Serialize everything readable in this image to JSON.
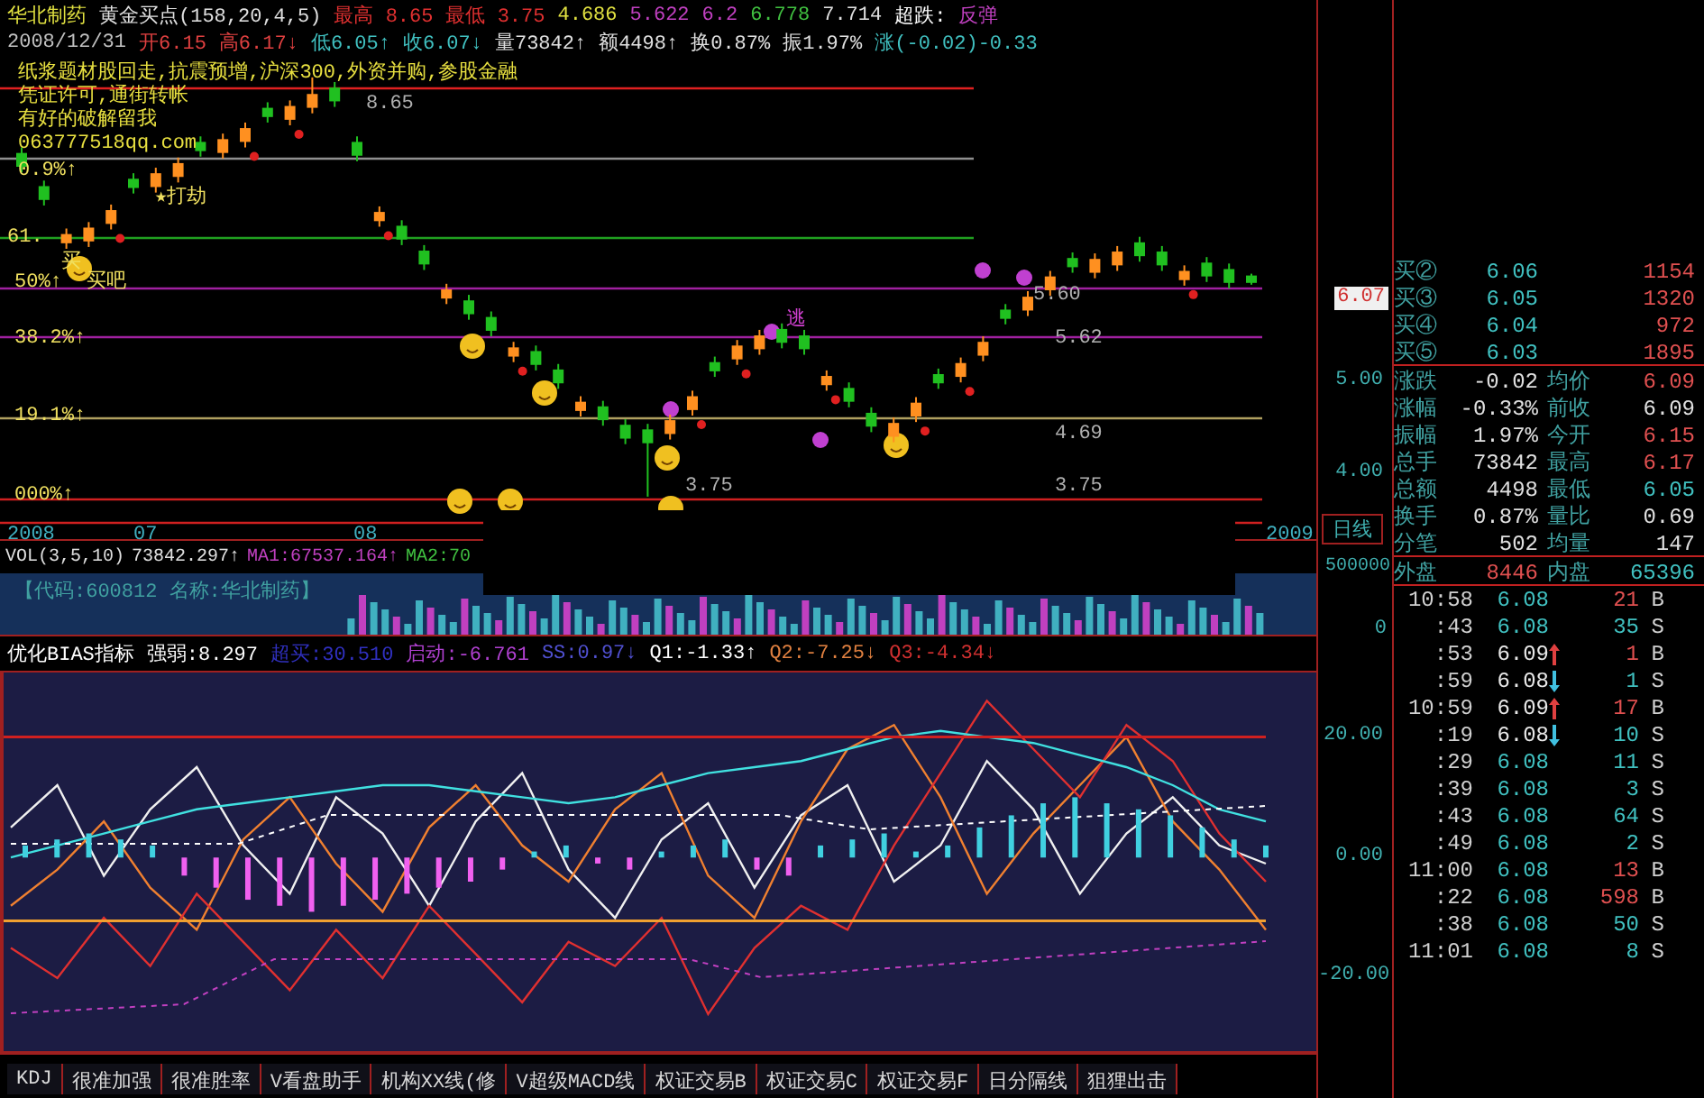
{
  "header": {
    "stock_name": "华北制药",
    "indicator_name": "黄金买点(158,20,4,5)",
    "indicator_values": [
      {
        "text": "最高 8.65",
        "color": "#e03030"
      },
      {
        "text": "最低 3.75",
        "color": "#e03030"
      },
      {
        "text": "4.686",
        "color": "#e0e040"
      },
      {
        "text": "5.622",
        "color": "#c040c0"
      },
      {
        "text": "6.2",
        "color": "#c040c0"
      },
      {
        "text": "6.778",
        "color": "#40c040"
      },
      {
        "text": "7.714",
        "color": "#e0e0e0"
      },
      {
        "text": "超跌:",
        "color": "#ffffff"
      },
      {
        "text": "反弹",
        "color": "#c040c0"
      }
    ],
    "quote_line": [
      {
        "text": "2008/12/31",
        "color": "#c0c0c0"
      },
      {
        "text": "开6.15",
        "color": "#e04040"
      },
      {
        "text": "高6.17↓",
        "color": "#e04040"
      },
      {
        "text": "低6.05↑",
        "color": "#40c0c0"
      },
      {
        "text": "收6.07↓",
        "color": "#40c0c0"
      },
      {
        "text": "量73842↑",
        "color": "#e0e0e0"
      },
      {
        "text": "额4498↑",
        "color": "#e0e0e0"
      },
      {
        "text": "换0.87%",
        "color": "#e0e0e0"
      },
      {
        "text": "振1.97%",
        "color": "#e0e0e0"
      },
      {
        "text": "涨(-0.02)-0.33",
        "color": "#40c0c0"
      }
    ]
  },
  "notes": [
    "纸浆题材股回走,抗震预增,沪深300,外资并购,参股金融",
    "凭证许可,通街转帐",
    "有好的破解留我",
    "063777518qq.com"
  ],
  "kline_labels": [
    {
      "text": "8.65",
      "kind": "price"
    },
    {
      "text": "★打劫",
      "kind": "signal"
    },
    {
      "text": "0.9%↑",
      "kind": "level"
    },
    {
      "text": "61.",
      "kind": "level"
    },
    {
      "text": "买",
      "kind": "signal"
    },
    {
      "text": "50%↑",
      "kind": "level"
    },
    {
      "text": "买吧",
      "kind": "signal"
    },
    {
      "text": "38.2%↑",
      "kind": "level"
    },
    {
      "text": "19.1%↑",
      "kind": "level"
    },
    {
      "text": "000%↑",
      "kind": "level"
    },
    {
      "text": "逃",
      "kind": "escape"
    },
    {
      "text": "5.60",
      "kind": "price"
    },
    {
      "text": "5.62",
      "kind": "price"
    },
    {
      "text": "4.69",
      "kind": "price"
    },
    {
      "text": "3.75",
      "kind": "price"
    },
    {
      "text": "3.75",
      "kind": "price"
    }
  ],
  "time_axis": [
    "2008",
    "07",
    "08",
    "2009"
  ],
  "kline": {
    "chart_data": {
      "type": "candlestick",
      "ylim": [
        3.27,
        9.14
      ],
      "yticks": [
        {
          "value": 5,
          "label": "5.00"
        },
        {
          "value": 4,
          "label": "4.00"
        }
      ],
      "ohlc": [
        [
          7.48,
          7.54,
          7.27,
          7.33
        ],
        [
          7.12,
          7.18,
          6.91,
          6.97
        ],
        [
          6.5,
          6.66,
          6.44,
          6.6
        ],
        [
          6.52,
          6.73,
          6.46,
          6.67
        ],
        [
          6.71,
          6.92,
          6.65,
          6.86
        ],
        [
          7.2,
          7.26,
          7.04,
          7.1
        ],
        [
          7.11,
          7.32,
          7.05,
          7.26
        ],
        [
          7.22,
          7.43,
          7.16,
          7.37
        ],
        [
          7.6,
          7.66,
          7.44,
          7.5
        ],
        [
          7.48,
          7.69,
          7.42,
          7.63
        ],
        [
          7.6,
          7.81,
          7.54,
          7.75
        ],
        [
          7.97,
          8.03,
          7.81,
          7.87
        ],
        [
          7.84,
          8.05,
          7.78,
          7.99
        ],
        [
          7.97,
          8.3,
          7.91,
          8.12
        ],
        [
          8.19,
          8.25,
          7.98,
          8.04
        ],
        [
          7.6,
          7.66,
          7.39,
          7.45
        ],
        [
          6.74,
          6.9,
          6.68,
          6.84
        ],
        [
          6.69,
          6.75,
          6.48,
          6.54
        ],
        [
          6.42,
          6.48,
          6.21,
          6.27
        ],
        [
          5.9,
          6.06,
          5.84,
          6.0
        ],
        [
          5.88,
          5.94,
          5.67,
          5.73
        ],
        [
          5.7,
          5.76,
          5.49,
          5.55
        ],
        [
          5.27,
          5.43,
          5.21,
          5.37
        ],
        [
          5.33,
          5.39,
          5.12,
          5.18
        ],
        [
          5.13,
          5.19,
          4.92,
          4.98
        ],
        [
          4.68,
          4.84,
          4.62,
          4.78
        ],
        [
          4.73,
          4.79,
          4.52,
          4.58
        ],
        [
          4.53,
          4.59,
          4.32,
          4.38
        ],
        [
          4.48,
          4.54,
          3.75,
          4.33
        ],
        [
          4.43,
          4.64,
          4.37,
          4.58
        ],
        [
          4.69,
          4.9,
          4.63,
          4.84
        ],
        [
          5.21,
          5.27,
          5.05,
          5.11
        ],
        [
          5.24,
          5.45,
          5.18,
          5.39
        ],
        [
          5.35,
          5.56,
          5.29,
          5.5
        ],
        [
          5.57,
          5.63,
          5.36,
          5.42
        ],
        [
          5.5,
          5.56,
          5.29,
          5.35
        ],
        [
          4.96,
          5.12,
          4.9,
          5.06
        ],
        [
          4.93,
          4.99,
          4.72,
          4.78
        ],
        [
          4.66,
          4.72,
          4.45,
          4.51
        ],
        [
          4.4,
          4.61,
          4.34,
          4.55
        ],
        [
          4.62,
          4.83,
          4.56,
          4.77
        ],
        [
          5.08,
          5.14,
          4.92,
          4.98
        ],
        [
          5.05,
          5.26,
          4.99,
          5.2
        ],
        [
          5.28,
          5.49,
          5.22,
          5.43
        ],
        [
          5.78,
          5.84,
          5.62,
          5.68
        ],
        [
          5.77,
          5.98,
          5.71,
          5.92
        ],
        [
          5.99,
          6.2,
          5.93,
          6.14
        ],
        [
          6.34,
          6.4,
          6.18,
          6.24
        ],
        [
          6.18,
          6.39,
          6.12,
          6.33
        ],
        [
          6.26,
          6.47,
          6.2,
          6.41
        ],
        [
          6.51,
          6.57,
          6.3,
          6.36
        ],
        [
          6.41,
          6.47,
          6.2,
          6.26
        ],
        [
          6.1,
          6.26,
          6.04,
          6.2
        ],
        [
          6.29,
          6.35,
          6.08,
          6.14
        ],
        [
          6.22,
          6.28,
          6.01,
          6.07
        ],
        [
          6.15,
          6.17,
          6.05,
          6.07
        ]
      ]
    }
  },
  "volume": {
    "items": [
      {
        "text": "VOL(3,5,10)",
        "color": "#e0e0e0"
      },
      {
        "text": "73842.297↑",
        "color": "#e0e0e0"
      },
      {
        "text": "MA1:67537.164↑",
        "color": "#c040c0"
      },
      {
        "text": "MA2:70",
        "color": "#40c040"
      }
    ],
    "stock_code": "【代码:600812 名称:华北制药】"
  },
  "bias": {
    "items": [
      {
        "text": "优化BIAS指标",
        "color": "#ffffff"
      },
      {
        "text": "强弱:8.297",
        "color": "#ffffff"
      },
      {
        "text": "超买:30.510",
        "color": "#3030c0"
      },
      {
        "text": "启动:-6.761",
        "color": "#b040d0"
      },
      {
        "text": "SS:0.97↓",
        "color": "#5050d0"
      },
      {
        "text": "Q1:-1.33↑",
        "color": "#ffffff"
      },
      {
        "text": "Q2:-7.25↓",
        "color": "#e08040"
      },
      {
        "text": "Q3:-4.34↓",
        "color": "#d03030"
      }
    ],
    "chart_data": {
      "type": "line",
      "ylim": [
        -39,
        31
      ],
      "yticks": [
        {
          "value": 20,
          "label": "20.00"
        },
        {
          "value": 0,
          "label": "0.00"
        },
        {
          "value": -20,
          "label": "-20.00"
        }
      ],
      "series": [
        {
          "color": "#f0f0f0",
          "values": [
            5,
            12,
            -3,
            8,
            15,
            2,
            -6,
            10,
            4,
            -8,
            6,
            14,
            -2,
            -10,
            3,
            9,
            -5,
            7,
            12,
            -4,
            2,
            16,
            8,
            -6,
            4,
            10,
            2,
            -1
          ]
        },
        {
          "color": "#f08030",
          "values": [
            -8,
            -2,
            6,
            -5,
            -12,
            3,
            10,
            -1,
            -9,
            5,
            12,
            2,
            -4,
            8,
            14,
            -3,
            -10,
            6,
            18,
            22,
            10,
            -6,
            4,
            12,
            20,
            6,
            -2,
            -12
          ]
        },
        {
          "color": "#e03030",
          "values": [
            -15,
            -20,
            -10,
            -18,
            -6,
            -14,
            -22,
            -12,
            -20,
            -8,
            -16,
            -24,
            -14,
            -18,
            -10,
            -26,
            -15,
            -8,
            -12,
            2,
            14,
            26,
            18,
            10,
            22,
            16,
            4,
            -4
          ]
        },
        {
          "color": "#40e0e0",
          "values": [
            0,
            2,
            4,
            6,
            8,
            9,
            10,
            11,
            12,
            12,
            11,
            10,
            9,
            10,
            12,
            14,
            15,
            16,
            18,
            20,
            21,
            20,
            19,
            17,
            15,
            12,
            8,
            6
          ]
        }
      ]
    }
  },
  "tabs": [
    {
      "label": "KDJ",
      "selected": false
    },
    {
      "label": "很准加强",
      "selected": false
    },
    {
      "label": "很准胜率",
      "selected": false
    },
    {
      "label": "V看盘助手",
      "selected": false
    },
    {
      "label": "机构XX线(修",
      "selected": false
    },
    {
      "label": "V超级MACD线",
      "selected": false
    },
    {
      "label": "权证交易B",
      "selected": false
    },
    {
      "label": "权证交易C",
      "selected": false
    },
    {
      "label": "权证交易F",
      "selected": false
    },
    {
      "label": "日分隔线",
      "selected": false
    },
    {
      "label": "狙狸出击",
      "selected": false
    }
  ],
  "price_axis": {
    "current_price": "6.07",
    "period": "日线",
    "volume_tick": "500000",
    "volume_zero": "0"
  },
  "order_book": [
    {
      "label": "买②",
      "price": "6.06",
      "volume": "1154"
    },
    {
      "label": "买③",
      "price": "6.05",
      "volume": "1320"
    },
    {
      "label": "买④",
      "price": "6.04",
      "volume": "972"
    },
    {
      "label": "买⑤",
      "price": "6.03",
      "volume": "1895"
    }
  ],
  "stats": [
    {
      "label": "涨跌",
      "value": "-0.02",
      "color": "#e0e0e0"
    },
    {
      "label": "均价",
      "value": "6.09",
      "color": "#e05050"
    },
    {
      "label": "涨幅",
      "value": "-0.33%",
      "color": "#e0e0e0"
    },
    {
      "label": "前收",
      "value": "6.09",
      "color": "#e0e0e0"
    },
    {
      "label": "振幅",
      "value": "1.97%",
      "color": "#e0e0e0"
    },
    {
      "label": "今开",
      "value": "6.15",
      "color": "#e05050"
    },
    {
      "label": "总手",
      "value": "73842",
      "color": "#e0e0e0"
    },
    {
      "label": "最高",
      "value": "6.17",
      "color": "#e05050"
    },
    {
      "label": "总额",
      "value": "4498",
      "color": "#e0e0e0"
    },
    {
      "label": "最低",
      "value": "6.05",
      "color": "#40c0c0"
    },
    {
      "label": "换手",
      "value": "0.87%",
      "color": "#e0e0e0"
    },
    {
      "label": "量比",
      "value": "0.69",
      "color": "#e0e0e0"
    },
    {
      "label": "分笔",
      "value": "502",
      "color": "#e0e0e0"
    },
    {
      "label": "均量",
      "value": "147",
      "color": "#e0e0e0"
    },
    {
      "label": "外盘",
      "value": "8446",
      "color": "#e05050"
    },
    {
      "label": "内盘",
      "value": "65396",
      "color": "#40c0c0"
    }
  ],
  "trades": [
    {
      "time": "10:58",
      "price": "6.08",
      "uptick": false,
      "downtick": false,
      "volume": "21",
      "side": "B",
      "kind": "buy"
    },
    {
      "time": ":43",
      "price": "6.08",
      "uptick": false,
      "downtick": false,
      "volume": "35",
      "side": "S",
      "kind": "sell"
    },
    {
      "time": ":53",
      "price": "6.09",
      "uptick": true,
      "downtick": false,
      "volume": "1",
      "side": "B",
      "kind": "buy"
    },
    {
      "time": ":59",
      "price": "6.08",
      "uptick": false,
      "downtick": true,
      "volume": "1",
      "side": "S",
      "kind": "sell"
    },
    {
      "time": "10:59",
      "price": "6.09",
      "uptick": true,
      "downtick": false,
      "volume": "17",
      "side": "B",
      "kind": "buy"
    },
    {
      "time": ":19",
      "price": "6.08",
      "uptick": false,
      "downtick": true,
      "volume": "10",
      "side": "S",
      "kind": "sell"
    },
    {
      "time": ":29",
      "price": "6.08",
      "uptick": false,
      "downtick": false,
      "volume": "11",
      "side": "S",
      "kind": "sell"
    },
    {
      "time": ":39",
      "price": "6.08",
      "uptick": false,
      "downtick": false,
      "volume": "3",
      "side": "S",
      "kind": "sell"
    },
    {
      "time": ":43",
      "price": "6.08",
      "uptick": false,
      "downtick": false,
      "volume": "64",
      "side": "S",
      "kind": "sell"
    },
    {
      "time": ":49",
      "price": "6.08",
      "uptick": false,
      "downtick": false,
      "volume": "2",
      "side": "S",
      "kind": "sell"
    },
    {
      "time": "11:00",
      "price": "6.08",
      "uptick": false,
      "downtick": false,
      "volume": "13",
      "side": "B",
      "kind": "buy"
    },
    {
      "time": ":22",
      "price": "6.08",
      "uptick": false,
      "downtick": false,
      "volume": "598",
      "side": "B",
      "kind": "buy"
    },
    {
      "time": ":38",
      "price": "6.08",
      "uptick": false,
      "downtick": false,
      "volume": "50",
      "side": "S",
      "kind": "sell"
    },
    {
      "time": "11:01",
      "price": "6.08",
      "uptick": false,
      "downtick": false,
      "volume": "8",
      "side": "S",
      "kind": "sell"
    }
  ]
}
